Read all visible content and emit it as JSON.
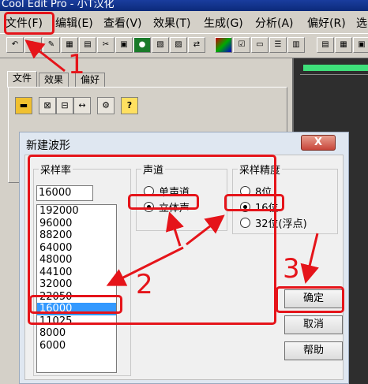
{
  "window": {
    "title": "Cool Edit Pro - 小T汉化"
  },
  "menu": [
    {
      "label": "文件(F)"
    },
    {
      "label": "编辑(E)"
    },
    {
      "label": "查看(V)"
    },
    {
      "label": "效果(T)"
    },
    {
      "label": "生成(G)"
    },
    {
      "label": "分析(A)"
    },
    {
      "label": "偏好(R)"
    },
    {
      "label": "选"
    }
  ],
  "panel": {
    "tabs": [
      "文件",
      "效果",
      "偏好"
    ]
  },
  "dialog": {
    "title": "新建波形",
    "close": "X",
    "sample_rate": {
      "legend": "采样率",
      "value": "16000",
      "options": [
        "192000",
        "96000",
        "88200",
        "64000",
        "48000",
        "44100",
        "32000",
        "22050",
        "16000",
        "11025",
        "8000",
        "6000"
      ],
      "selected": "16000"
    },
    "channels": {
      "legend": "声道",
      "options": [
        "单声道",
        "立体声"
      ],
      "selected": "立体声"
    },
    "resolution": {
      "legend": "采样精度",
      "options": [
        "8位",
        "16位",
        "32位(浮点)"
      ],
      "selected": "16位"
    },
    "buttons": {
      "ok": "确定",
      "cancel": "取消",
      "help": "帮助"
    }
  },
  "annotations": [
    "1",
    "2",
    "3"
  ],
  "colors": {
    "annotation": "#e5141a",
    "selection": "#3399ff",
    "title_bar": "#0b2a7a",
    "close_button": "#c8463a"
  }
}
